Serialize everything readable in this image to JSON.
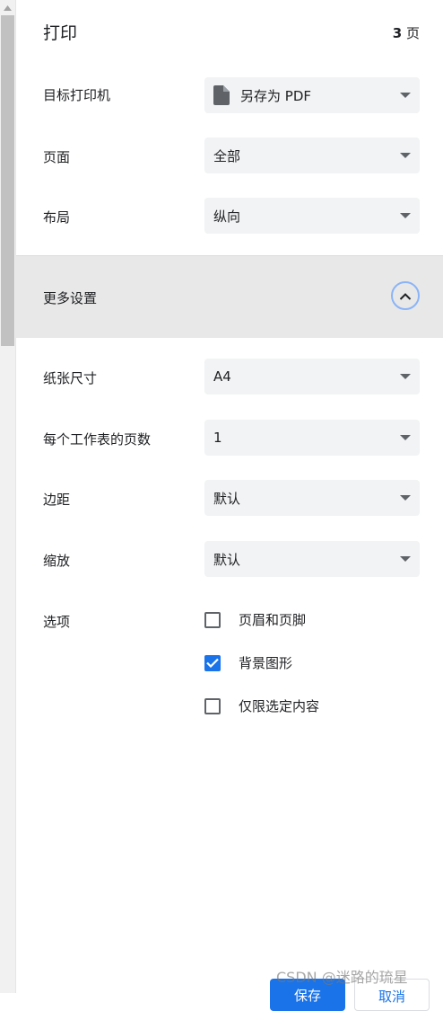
{
  "header": {
    "title": "打印",
    "page_count_number": "3",
    "page_count_unit": "页"
  },
  "settings": {
    "destination": {
      "label": "目标打印机",
      "value": "另存为 PDF",
      "icon": "file-icon"
    },
    "pages": {
      "label": "页面",
      "value": "全部"
    },
    "layout": {
      "label": "布局",
      "value": "纵向"
    }
  },
  "more_settings": {
    "label": "更多设置",
    "icon": "chevron-up-icon",
    "accent": "#8ab4f8"
  },
  "advanced": {
    "paper_size": {
      "label": "纸张尺寸",
      "value": "A4"
    },
    "pages_per_sheet": {
      "label": "每个工作表的页数",
      "value": "1"
    },
    "margins": {
      "label": "边距",
      "value": "默认"
    },
    "scale": {
      "label": "缩放",
      "value": "默认"
    },
    "options": {
      "label": "选项",
      "items": [
        {
          "label": "页眉和页脚",
          "checked": false
        },
        {
          "label": "背景图形",
          "checked": true
        },
        {
          "label": "仅限选定内容",
          "checked": false
        }
      ]
    }
  },
  "footer": {
    "save_label": "保存",
    "cancel_label": "取消"
  },
  "watermark": "CSDN @迷路的琉星",
  "colors": {
    "primary": "#1a73e8",
    "dropdown_bg": "#f1f3f4",
    "section_bg": "#e8e8e8"
  }
}
